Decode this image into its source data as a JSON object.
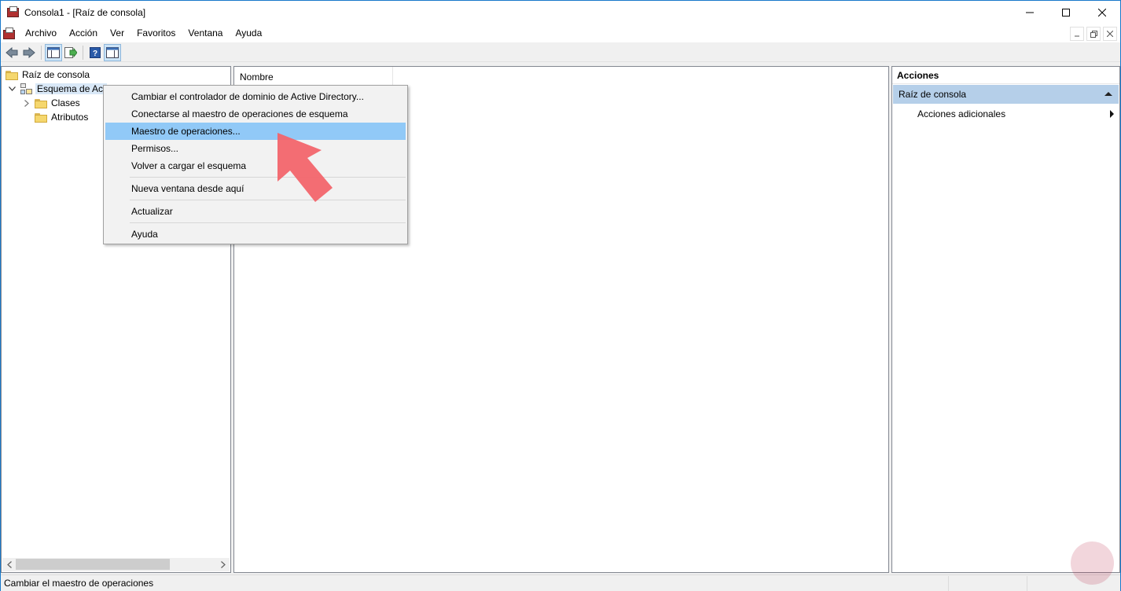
{
  "window": {
    "title": "Consola1 - [Raíz de consola]"
  },
  "menubar": {
    "items": [
      "Archivo",
      "Acción",
      "Ver",
      "Favoritos",
      "Ventana",
      "Ayuda"
    ]
  },
  "tree": {
    "root": "Raíz de consola",
    "schema_node": "Esquema de Act",
    "children": [
      "Clases",
      "Atributos"
    ]
  },
  "list": {
    "column_header": "Nombre"
  },
  "actions": {
    "header": "Acciones",
    "section": "Raíz de consola",
    "item": "Acciones adicionales"
  },
  "context_menu": {
    "items": [
      "Cambiar el controlador de dominio de Active Directory...",
      "Conectarse al maestro de operaciones de esquema",
      "Maestro de operaciones...",
      "Permisos...",
      "Volver a cargar el esquema",
      "Nueva ventana desde aquí",
      "Actualizar",
      "Ayuda"
    ],
    "highlighted_index": 2
  },
  "statusbar": {
    "text": "Cambiar el maestro de operaciones"
  },
  "colors": {
    "menu_highlight": "#91c9f7",
    "section_header": "#b5cfe9",
    "annotation_arrow": "#f2656b"
  },
  "icons": [
    "app-console-icon",
    "back-icon",
    "forward-icon",
    "show-tree-icon",
    "export-icon",
    "help-icon",
    "show-actions-icon",
    "folder-icon",
    "schema-icon"
  ]
}
